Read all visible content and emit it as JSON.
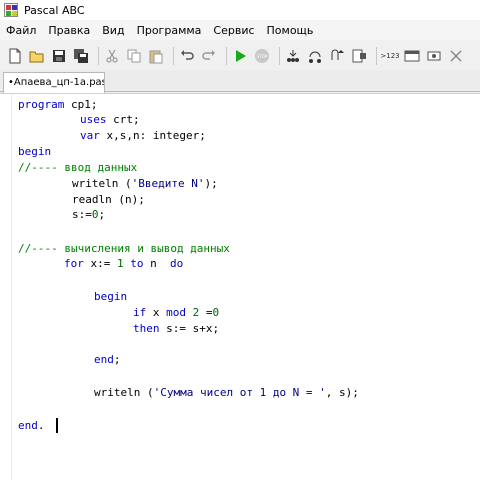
{
  "window": {
    "title": "Pascal ABC"
  },
  "menu": {
    "items": [
      "Файл",
      "Правка",
      "Вид",
      "Программа",
      "Сервис",
      "Помощь"
    ]
  },
  "toolbar": {
    "buttons": [
      "new-file",
      "open-file",
      "save",
      "save-all",
      "cut",
      "copy",
      "paste",
      "undo",
      "redo",
      "run",
      "stop",
      "step-into",
      "step-over",
      "step-out",
      "watch",
      "123",
      "form",
      "settings",
      "close"
    ],
    "counter_label": ">123"
  },
  "tabs": [
    {
      "label": "•Апаева_цп-1а.pas"
    }
  ],
  "editor": {
    "lines": {
      "l1_kw": "program",
      "l1_tx": " cp1;",
      "l2_kw": "uses",
      "l2_tx": " crt;",
      "l3_kw": "var",
      "l3_tx": " x,s,n: integer;",
      "l4_kw": "begin",
      "l5_cm": "//---- ввод данных",
      "l6_tx1": "writeln (",
      "l6_st": "'Введите N'",
      "l6_tx2": ");",
      "l7_tx": "readln (n);",
      "l8_tx": "s:=",
      "l8_nm": "0",
      "l8_tx2": ";",
      "l9_cm": "//---- вычисления и вывод данных",
      "l10_kw1": "for",
      "l10_tx1": " x:= ",
      "l10_nm": "1",
      "l10_kw2": " to",
      "l10_tx2": " n  ",
      "l10_kw3": "do",
      "l11_kw": "begin",
      "l12_kw": "if",
      "l12_tx": " x ",
      "l12_kw2": "mod",
      "l12_tx2": " ",
      "l12_nm": "2",
      "l12_tx3": " =",
      "l12_nm2": "0",
      "l13_kw": "then",
      "l13_tx": " s:= s+x;",
      "l14_kw": "end",
      "l14_tx": ";",
      "l15_tx1": "writeln (",
      "l15_st": "'Сумма чисел от 1 до N = '",
      "l15_tx2": ", s);",
      "l16_kw": "end",
      "l16_tx": "."
    }
  }
}
